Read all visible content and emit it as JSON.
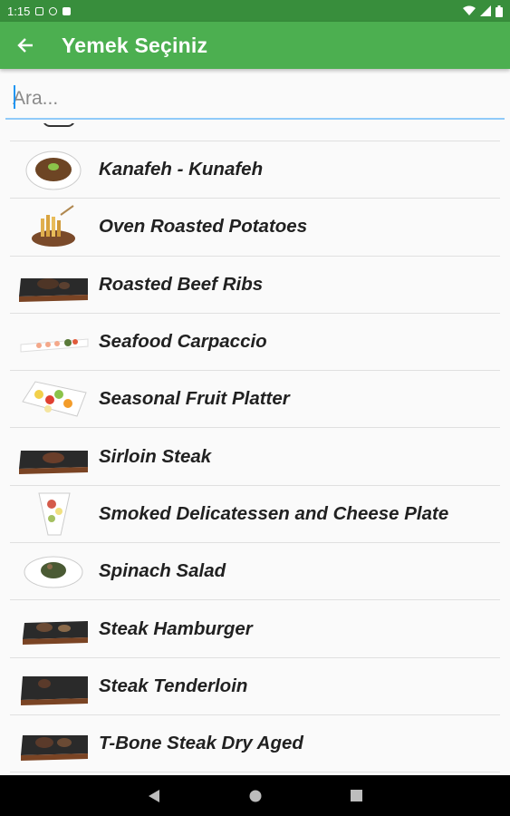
{
  "status_bar": {
    "time": "1:15"
  },
  "app_bar": {
    "title": "Yemek Seçiniz",
    "back_icon": "arrow-back-icon"
  },
  "search": {
    "placeholder": "Ara...",
    "value": ""
  },
  "items": [
    {
      "label": "Kanafeh - Kunafeh",
      "thumb": "kunafeh-plate"
    },
    {
      "label": "Oven Roasted Potatoes",
      "thumb": "potatoes-board"
    },
    {
      "label": "Roasted Beef Ribs",
      "thumb": "slate-board"
    },
    {
      "label": "Seafood Carpaccio",
      "thumb": "long-plate"
    },
    {
      "label": "Seasonal Fruit Platter",
      "thumb": "fruit-platter"
    },
    {
      "label": "Sirloin Steak",
      "thumb": "slate-board"
    },
    {
      "label": "Smoked Delicatessen and Cheese Plate",
      "thumb": "deli-plate"
    },
    {
      "label": "Spinach Salad",
      "thumb": "salad-plate"
    },
    {
      "label": "Steak Hamburger",
      "thumb": "slate-board"
    },
    {
      "label": "Steak Tenderloin",
      "thumb": "slate-board"
    },
    {
      "label": "T-Bone Steak Dry Aged",
      "thumb": "slate-board"
    }
  ],
  "colors": {
    "status_bar": "#388e3c",
    "app_bar": "#4caf50",
    "search_underline": "#90caf9",
    "nav_bar": "#000000"
  }
}
